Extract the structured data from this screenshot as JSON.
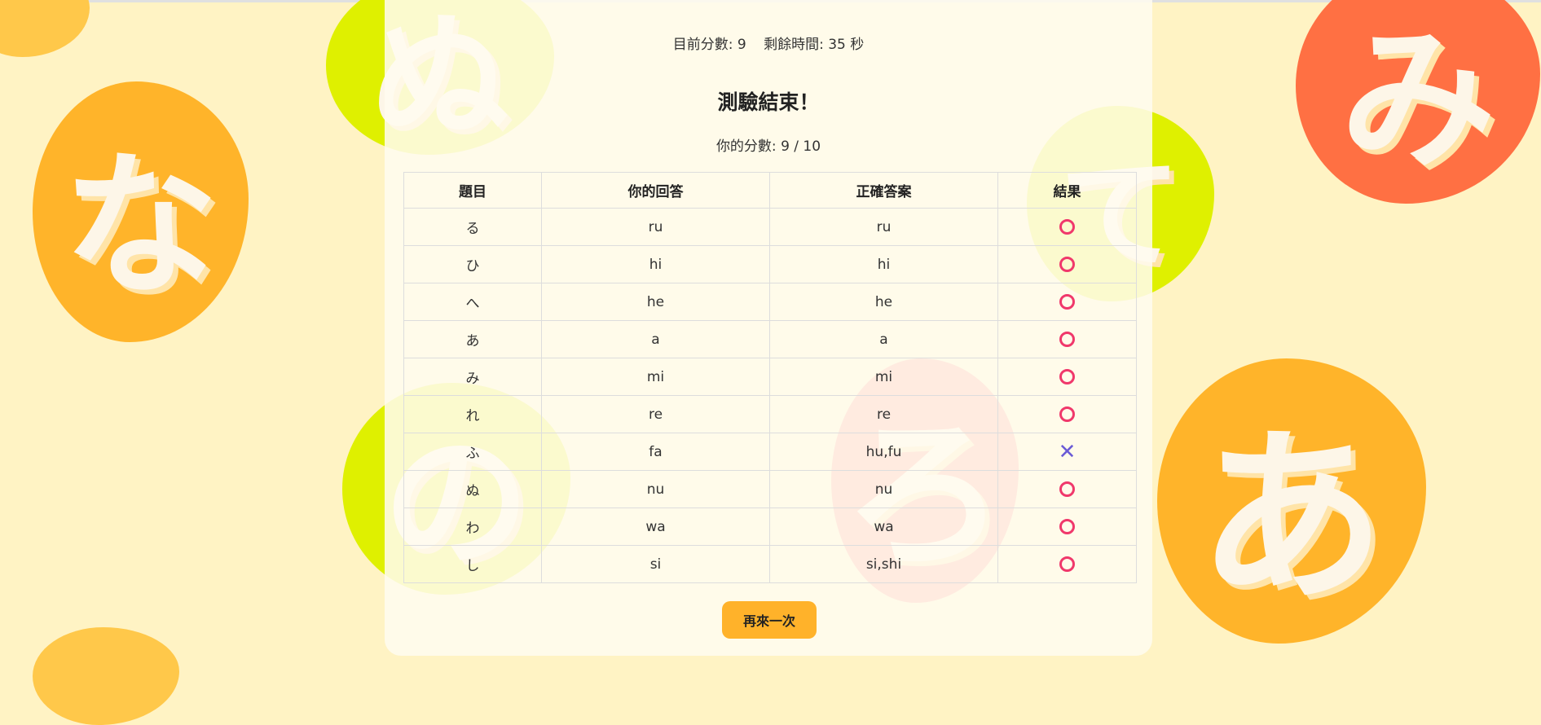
{
  "status": {
    "score_text": "目前分數: 9",
    "time_text": "剩餘時間: 35 秒"
  },
  "result": {
    "title": "測驗結束！",
    "final_score": "你的分數: 9 / 10"
  },
  "table": {
    "headers": [
      "題目",
      "你的回答",
      "正確答案",
      "結果"
    ],
    "rows": [
      {
        "question": "る",
        "answer": "ru",
        "correct": "ru",
        "result": "correct"
      },
      {
        "question": "ひ",
        "answer": "hi",
        "correct": "hi",
        "result": "correct"
      },
      {
        "question": "へ",
        "answer": "he",
        "correct": "he",
        "result": "correct"
      },
      {
        "question": "あ",
        "answer": "a",
        "correct": "a",
        "result": "correct"
      },
      {
        "question": "み",
        "answer": "mi",
        "correct": "mi",
        "result": "correct"
      },
      {
        "question": "れ",
        "answer": "re",
        "correct": "re",
        "result": "correct"
      },
      {
        "question": "ふ",
        "answer": "fa",
        "correct": "hu,fu",
        "result": "wrong"
      },
      {
        "question": "ぬ",
        "answer": "nu",
        "correct": "nu",
        "result": "correct"
      },
      {
        "question": "わ",
        "answer": "wa",
        "correct": "wa",
        "result": "correct"
      },
      {
        "question": "し",
        "answer": "si",
        "correct": "si,shi",
        "result": "correct"
      }
    ]
  },
  "retry_button": "再來一次",
  "background_glyphs": [
    {
      "char": "な",
      "color": "#ffb42a"
    },
    {
      "char": "み",
      "color": "#ff7043"
    },
    {
      "char": "あ",
      "color": "#ffb42a"
    },
    {
      "char": "ぬ",
      "color": "#dff000"
    },
    {
      "char": "て",
      "color": "#dff000"
    },
    {
      "char": "の",
      "color": "#dff000"
    },
    {
      "char": "ろ",
      "color": "#ff8a80"
    }
  ],
  "colors": {
    "background": "#fff3c4",
    "correct_mark": "#f0386b",
    "wrong_mark": "#6b5bd6",
    "button": "#ffb22a"
  }
}
